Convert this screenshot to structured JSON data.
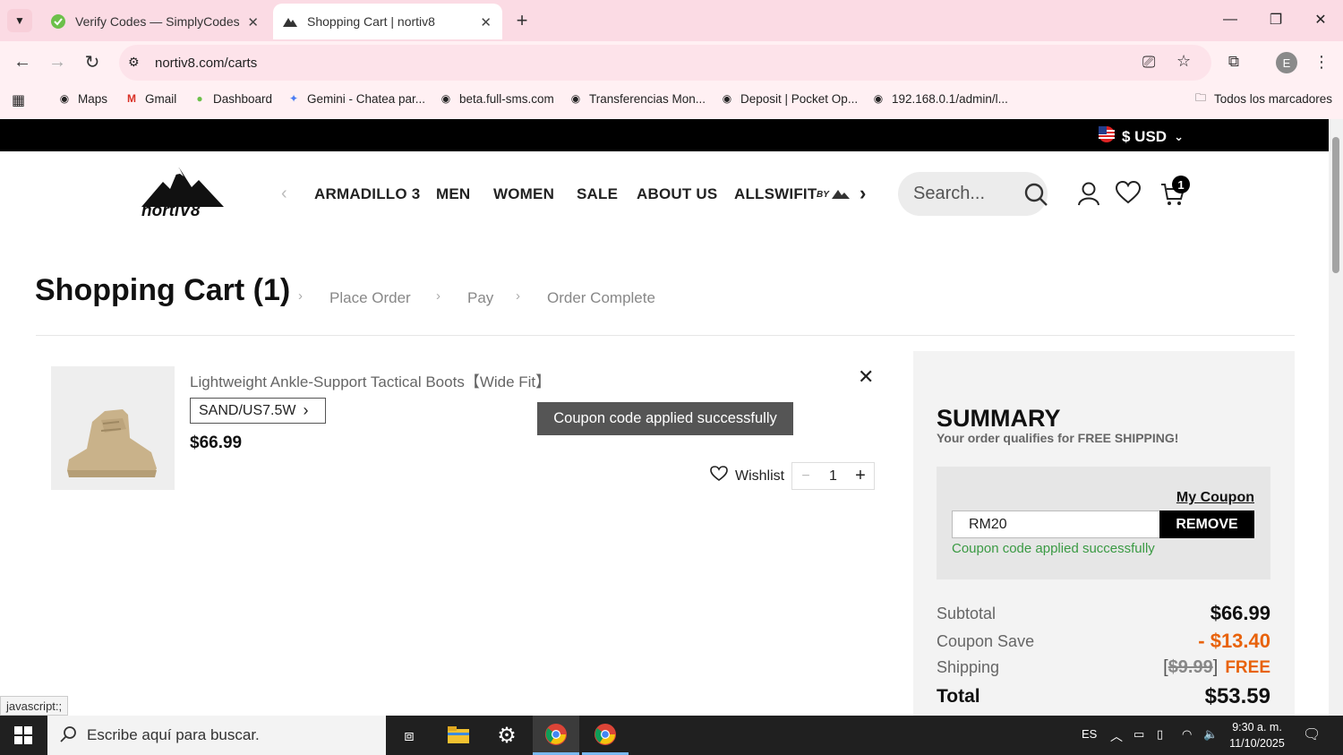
{
  "browser": {
    "tabs": [
      {
        "title": "Verify Codes — SimplyCodes",
        "active": false
      },
      {
        "title": "Shopping Cart | nortiv8",
        "active": true
      }
    ],
    "url": "nortiv8.com/carts",
    "bookmarks": [
      {
        "label": "Maps"
      },
      {
        "label": "Gmail"
      },
      {
        "label": "Dashboard"
      },
      {
        "label": "Gemini - Chatea par..."
      },
      {
        "label": "beta.full-sms.com"
      },
      {
        "label": "Transferencias Mon..."
      },
      {
        "label": "Deposit | Pocket Op..."
      },
      {
        "label": "192.168.0.1/admin/l..."
      }
    ],
    "all_bookmarks": "Todos los marcadores",
    "profile_initial": "E",
    "status_text": "javascript:;"
  },
  "site": {
    "currency": "$ USD",
    "logo_text": "nortiV8",
    "nav": [
      "ARMADILLO 3",
      "MEN",
      "WOMEN",
      "SALE",
      "ABOUT US",
      "ALLSWIFIT"
    ],
    "nav_suffix": "BY",
    "search_placeholder": "Search...",
    "cart_count": "1"
  },
  "page": {
    "title": "Shopping Cart (1)",
    "steps": [
      "Place Order",
      "Pay",
      "Order Complete"
    ]
  },
  "cart": {
    "item": {
      "name": "Lightweight Ankle-Support Tactical Boots【Wide Fit】",
      "variant": "SAND/US7.5W",
      "price": "$66.99",
      "quantity": "1"
    },
    "wishlist_label": "Wishlist",
    "toast": "Coupon code applied successfully"
  },
  "summary": {
    "title": "SUMMARY",
    "note": "Your order qualifies for FREE SHIPPING!",
    "my_coupon": "My Coupon",
    "coupon_code": "RM20",
    "remove_label": "REMOVE",
    "coupon_message": "Coupon code applied successfully",
    "rows": {
      "subtotal_label": "Subtotal",
      "subtotal": "$66.99",
      "coupon_label": "Coupon Save",
      "coupon_save": "- $13.40",
      "shipping_label": "Shipping",
      "shipping_original": "$9.99",
      "shipping_value": "FREE",
      "total_label": "Total",
      "total": "$53.59"
    },
    "colors": {
      "save": "#e8620a",
      "free": "#e8620a",
      "success": "#3a9a43"
    }
  },
  "taskbar": {
    "search_placeholder": "Escribe aquí para buscar.",
    "language": "ES",
    "time": "9:30 a. m.",
    "date": "11/10/2025"
  }
}
